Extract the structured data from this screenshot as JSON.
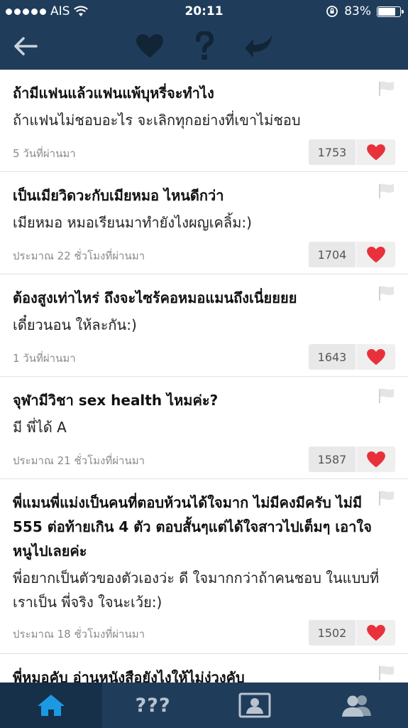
{
  "status_bar": {
    "carrier": "AIS",
    "time": "20:11",
    "battery_percent": "83%",
    "battery_level": 0.83
  },
  "nav": {
    "back_icon": "back-arrow-icon",
    "actions": [
      "heart-icon",
      "question-icon",
      "reply-icon"
    ]
  },
  "posts": [
    {
      "title": "ถ้ามีแฟนแล้วแฟนแพ้บุหรี่จะทำไง",
      "answer": "ถ้าแฟนไม่ชอบอะไร จะเลิกทุกอย่างที่เขาไม่ชอบ",
      "time": "5 วันที่ผ่านมา",
      "likes": "1753"
    },
    {
      "title": "เป็นเมียวิดวะกับเมียหมอ ไหนดีกว่า",
      "answer": "เมียหมอ หมอเรียนมาทำยังไงผญเคลิ้ม:)",
      "time": "ประมาณ 22 ชั่วโมงที่ผ่านมา",
      "likes": "1704"
    },
    {
      "title": "ต้องสูงเท่าไหร่ ถึงจะไซร้คอหมอแมนถึงเนี่ยยยย",
      "answer": "เดี๋ยวนอน ให้ละกัน:)",
      "time": "1 วันที่ผ่านมา",
      "likes": "1643"
    },
    {
      "title": "จุฬามีวิชา sex health ไหมค่ะ?",
      "answer": "มี พี่ได้ A",
      "time": "ประมาณ 21 ชั่วโมงที่ผ่านมา",
      "likes": "1587"
    },
    {
      "title": "พี่แมนพี่แม่งเป็นคนที่ตอบห้วนได้ใจมาก ไม่มีคงมีครับ ไม่มี 555 ต่อท้ายเกิน 4 ตัว ตอบสั้นๆแต่ได้ใจสาวไปเต็มๆ เอาใจหนูไปเลยค่ะ",
      "answer": "พี่อยากเป็นตัวของตัวเองว่ะ ดี ใจมากกว่าถ้าคนชอบ ในแบบที่เราเป็น พี่จริง ใจนะเว้ย:)",
      "time": "ประมาณ 18 ชั่วโมงที่ผ่านมา",
      "likes": "1502"
    },
    {
      "title": "พี่หมอคับ อ่านหนังสือยังไงให้ไม่ง่วงคับ"
    }
  ],
  "tabs": [
    {
      "name": "home",
      "icon": "home-icon",
      "active": true
    },
    {
      "name": "questions",
      "label": "???",
      "active": false
    },
    {
      "name": "profile",
      "icon": "profile-card-icon",
      "active": false
    },
    {
      "name": "friends",
      "icon": "people-icon",
      "active": false
    }
  ],
  "colors": {
    "bar": "#1f3d5b",
    "bar_icon": "#b9c3cf",
    "active_tab": "#16304a",
    "home_icon": "#1b9ae3",
    "heart": "#e8313b"
  }
}
